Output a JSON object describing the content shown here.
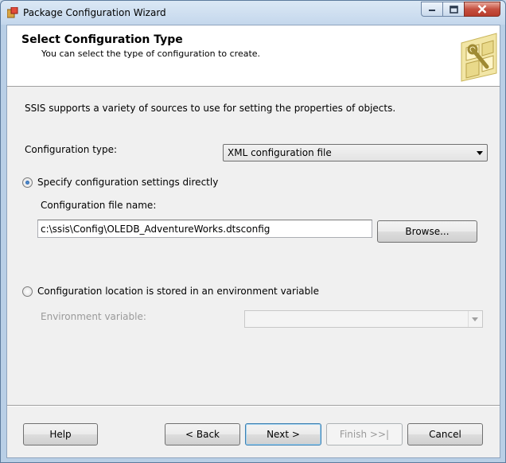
{
  "window": {
    "title": "Package Configuration Wizard"
  },
  "header": {
    "title": "Select Configuration Type",
    "subtitle": "You can select the type of configuration to create."
  },
  "description": "SSIS supports a variety of sources to use for setting the properties of objects.",
  "config_type": {
    "label": "Configuration type:",
    "value": "XML configuration file"
  },
  "option_direct": {
    "label": "Specify configuration settings directly",
    "selected": true
  },
  "config_file": {
    "label": "Configuration file name:",
    "value": "c:\\ssis\\Config\\OLEDB_AdventureWorks.dtsconfig"
  },
  "browse_button": "Browse...",
  "option_env": {
    "label": "Configuration location is stored in an environment variable",
    "selected": false
  },
  "env_variable": {
    "label": "Environment variable:",
    "value": ""
  },
  "buttons": {
    "help": "Help",
    "back": "< Back",
    "next": "Next >",
    "finish": "Finish >>|",
    "cancel": "Cancel"
  }
}
